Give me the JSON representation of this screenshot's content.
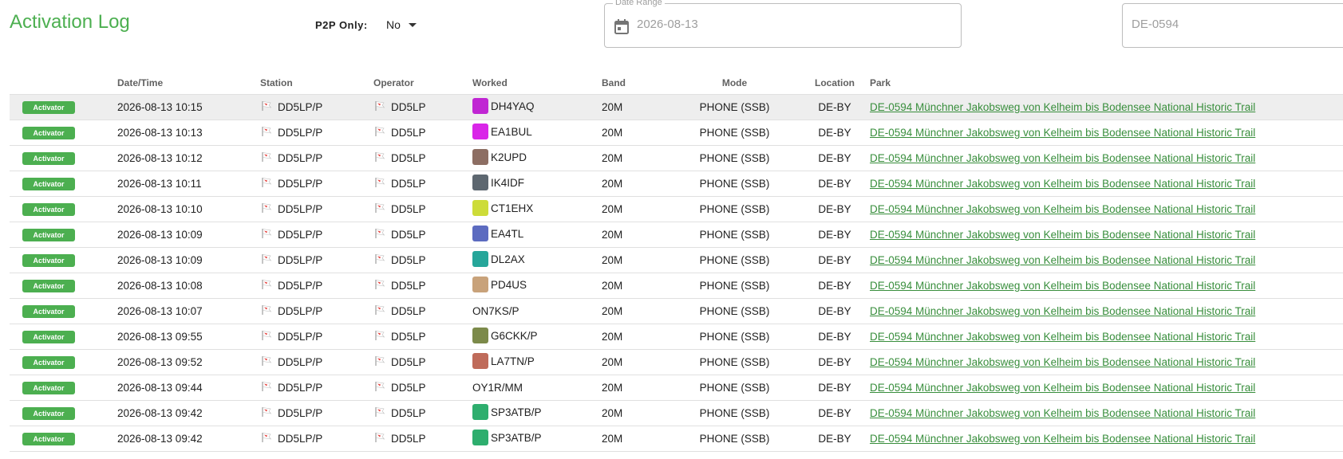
{
  "header": {
    "title": "Activation Log",
    "p2p_label": "P2P Only:",
    "p2p_value": "No",
    "date_range_label": "Date Range",
    "date_range_value": "2026-08-13",
    "park_value": "DE-0594"
  },
  "table": {
    "columns": [
      "",
      "Date/Time",
      "Station",
      "Operator",
      "Worked",
      "Band",
      "Mode",
      "Location",
      "Park"
    ],
    "rows": [
      {
        "role": "Activator",
        "datetime": "2026-08-13 10:15",
        "station": "DD5LP/P",
        "operator": "DD5LP",
        "worked": "DH4YAQ",
        "avatar": "#c026d3",
        "band": "20M",
        "mode": "PHONE (SSB)",
        "location": "DE-BY",
        "park": "DE-0594 Münchner Jakobsweg von Kelheim bis Bodensee National Historic Trail",
        "highlighted": true
      },
      {
        "role": "Activator",
        "datetime": "2026-08-13 10:13",
        "station": "DD5LP/P",
        "operator": "DD5LP",
        "worked": "EA1BUL",
        "avatar": "#d926e8",
        "band": "20M",
        "mode": "PHONE (SSB)",
        "location": "DE-BY",
        "park": "DE-0594 Münchner Jakobsweg von Kelheim bis Bodensee National Historic Trail",
        "highlighted": false
      },
      {
        "role": "Activator",
        "datetime": "2026-08-13 10:12",
        "station": "DD5LP/P",
        "operator": "DD5LP",
        "worked": "K2UPD",
        "avatar": "#8d6e63",
        "band": "20M",
        "mode": "PHONE (SSB)",
        "location": "DE-BY",
        "park": "DE-0594 Münchner Jakobsweg von Kelheim bis Bodensee National Historic Trail",
        "highlighted": false
      },
      {
        "role": "Activator",
        "datetime": "2026-08-13 10:11",
        "station": "DD5LP/P",
        "operator": "DD5LP",
        "worked": "IK4IDF",
        "avatar": "#5d6770",
        "band": "20M",
        "mode": "PHONE (SSB)",
        "location": "DE-BY",
        "park": "DE-0594 Münchner Jakobsweg von Kelheim bis Bodensee National Historic Trail",
        "highlighted": false
      },
      {
        "role": "Activator",
        "datetime": "2026-08-13 10:10",
        "station": "DD5LP/P",
        "operator": "DD5LP",
        "worked": "CT1EHX",
        "avatar": "#cddc39",
        "band": "20M",
        "mode": "PHONE (SSB)",
        "location": "DE-BY",
        "park": "DE-0594 Münchner Jakobsweg von Kelheim bis Bodensee National Historic Trail",
        "highlighted": false
      },
      {
        "role": "Activator",
        "datetime": "2026-08-13 10:09",
        "station": "DD5LP/P",
        "operator": "DD5LP",
        "worked": "EA4TL",
        "avatar": "#5c6bc0",
        "band": "20M",
        "mode": "PHONE (SSB)",
        "location": "DE-BY",
        "park": "DE-0594 Münchner Jakobsweg von Kelheim bis Bodensee National Historic Trail",
        "highlighted": false
      },
      {
        "role": "Activator",
        "datetime": "2026-08-13 10:09",
        "station": "DD5LP/P",
        "operator": "DD5LP",
        "worked": "DL2AX",
        "avatar": "#26a69a",
        "band": "20M",
        "mode": "PHONE (SSB)",
        "location": "DE-BY",
        "park": "DE-0594 Münchner Jakobsweg von Kelheim bis Bodensee National Historic Trail",
        "highlighted": false
      },
      {
        "role": "Activator",
        "datetime": "2026-08-13 10:08",
        "station": "DD5LP/P",
        "operator": "DD5LP",
        "worked": "PD4US",
        "avatar": "#c8a27a",
        "band": "20M",
        "mode": "PHONE (SSB)",
        "location": "DE-BY",
        "park": "DE-0594 Münchner Jakobsweg von Kelheim bis Bodensee National Historic Trail",
        "highlighted": false
      },
      {
        "role": "Activator",
        "datetime": "2026-08-13 10:07",
        "station": "DD5LP/P",
        "operator": "DD5LP",
        "worked": "ON7KS/P",
        "avatar": "",
        "band": "20M",
        "mode": "PHONE (SSB)",
        "location": "DE-BY",
        "park": "DE-0594 Münchner Jakobsweg von Kelheim bis Bodensee National Historic Trail",
        "highlighted": false
      },
      {
        "role": "Activator",
        "datetime": "2026-08-13 09:55",
        "station": "DD5LP/P",
        "operator": "DD5LP",
        "worked": "G6CKK/P",
        "avatar": "#7c8a4a",
        "band": "20M",
        "mode": "PHONE (SSB)",
        "location": "DE-BY",
        "park": "DE-0594 Münchner Jakobsweg von Kelheim bis Bodensee National Historic Trail",
        "highlighted": false
      },
      {
        "role": "Activator",
        "datetime": "2026-08-13 09:52",
        "station": "DD5LP/P",
        "operator": "DD5LP",
        "worked": "LA7TN/P",
        "avatar": "#bf6b5a",
        "band": "20M",
        "mode": "PHONE (SSB)",
        "location": "DE-BY",
        "park": "DE-0594 Münchner Jakobsweg von Kelheim bis Bodensee National Historic Trail",
        "highlighted": false
      },
      {
        "role": "Activator",
        "datetime": "2026-08-13 09:44",
        "station": "DD5LP/P",
        "operator": "DD5LP",
        "worked": "OY1R/MM",
        "avatar": "",
        "band": "20M",
        "mode": "PHONE (SSB)",
        "location": "DE-BY",
        "park": "DE-0594 Münchner Jakobsweg von Kelheim bis Bodensee National Historic Trail",
        "highlighted": false
      },
      {
        "role": "Activator",
        "datetime": "2026-08-13 09:42",
        "station": "DD5LP/P",
        "operator": "DD5LP",
        "worked": "SP3ATB/P",
        "avatar": "#2eae6e",
        "band": "20M",
        "mode": "PHONE (SSB)",
        "location": "DE-BY",
        "park": "DE-0594 Münchner Jakobsweg von Kelheim bis Bodensee National Historic Trail",
        "highlighted": false
      },
      {
        "role": "Activator",
        "datetime": "2026-08-13 09:42",
        "station": "DD5LP/P",
        "operator": "DD5LP",
        "worked": "SP3ATB/P",
        "avatar": "#2eae6e",
        "band": "20M",
        "mode": "PHONE (SSB)",
        "location": "DE-BY",
        "park": "DE-0594 Münchner Jakobsweg von Kelheim bis Bodensee National Historic Trail",
        "highlighted": false
      }
    ]
  },
  "colors": {
    "accent": "#4caf50",
    "link": "#388e3c",
    "row_highlight": "#eeeeee"
  }
}
